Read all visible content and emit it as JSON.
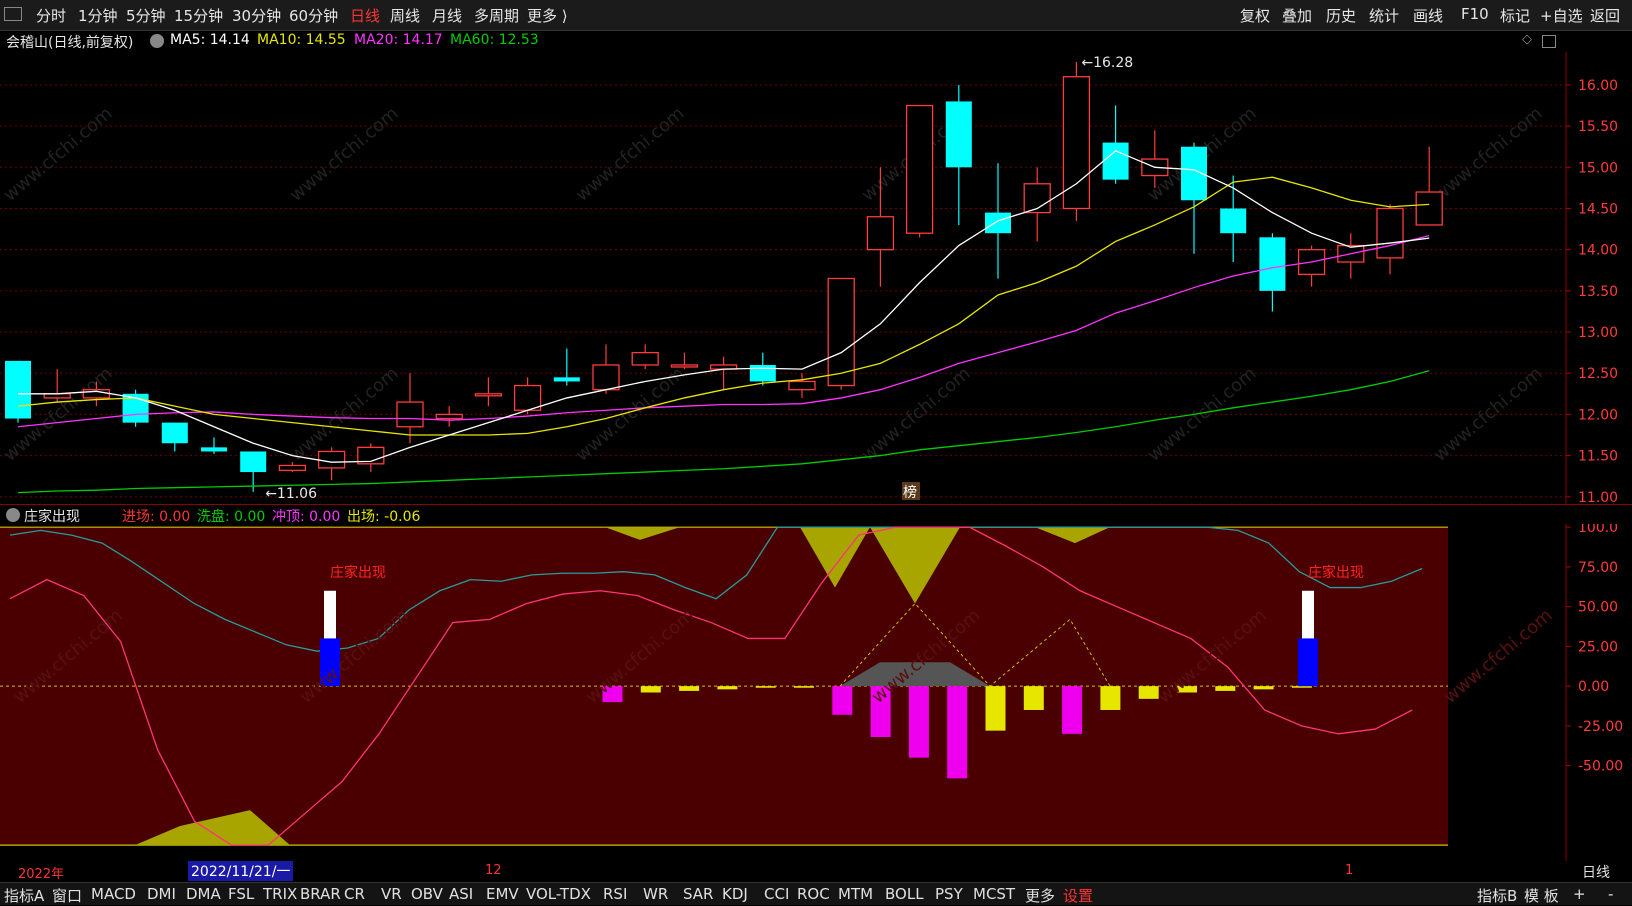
{
  "toolbar": {
    "left_items": [
      "分时",
      "1分钟",
      "5分钟",
      "15分钟",
      "30分钟",
      "60分钟",
      "日线",
      "周线",
      "月线",
      "多周期",
      "更多 ⟩"
    ],
    "active_item": "日线",
    "right_items": [
      "复权",
      "叠加",
      "历史",
      "统计",
      "画线",
      "F10",
      "标记",
      "+自选",
      "返回"
    ]
  },
  "main_legend": {
    "stock": "会稽山(日线,前复权)",
    "ma5_label": "MA5: 14.14",
    "ma10_label": "MA10: 14.55",
    "ma20_label": "MA20: 14.17",
    "ma60_label": "MA60: 12.53",
    "colors": {
      "ma5": "#ffffff",
      "ma10": "#e6e600",
      "ma20": "#ff33ff",
      "ma60": "#00cc00"
    }
  },
  "price_axis": [
    "16.00",
    "15.50",
    "15.00",
    "14.50",
    "14.00",
    "13.50",
    "13.00",
    "12.50",
    "12.00",
    "11.50",
    "11.00"
  ],
  "annotations": {
    "high": "16.28",
    "low": "11.06",
    "rank_badge": "榜"
  },
  "sub_legend": {
    "name": "庄家出现",
    "entry_label": "进场: 0.00",
    "wash_label": "洗盘: 0.00",
    "rush_label": "冲顶: 0.00",
    "exit_label": "出场: -0.06"
  },
  "sub_axis": [
    "100.0",
    "75.00",
    "50.00",
    "25.00",
    "0.00",
    "-25.00",
    "-50.00"
  ],
  "sub_annotations": [
    "庄家出现",
    "庄家出现"
  ],
  "date_bar": {
    "year": "2022年",
    "cursor_date": "2022/11/21/一",
    "month_12": "12",
    "month_1": "1",
    "period": "日线"
  },
  "bottom_tabs": [
    "指标A",
    "窗口",
    "MACD",
    "DMI",
    "DMA",
    "FSL",
    "TRIX",
    "BRAR",
    "CR",
    "VR",
    "OBV",
    "ASI",
    "EMV",
    "VOL-TDX",
    "RSI",
    "WR",
    "SAR",
    "KDJ",
    "CCI",
    "ROC",
    "MTM",
    "BOLL",
    "PSY",
    "MCST",
    "更多",
    "设置"
  ],
  "bottom_right": [
    "指标B",
    "模 板",
    "+",
    "-"
  ],
  "watermark": "www.cfchi.com",
  "chart_data": {
    "type": "candlestick",
    "candles": [
      {
        "o": 12.65,
        "c": 11.95,
        "h": 12.65,
        "l": 11.9
      },
      {
        "o": 12.2,
        "c": 12.25,
        "h": 12.55,
        "l": 12.15
      },
      {
        "o": 12.2,
        "c": 12.3,
        "h": 12.4,
        "l": 12.1
      },
      {
        "o": 12.25,
        "c": 11.9,
        "h": 12.3,
        "l": 11.85
      },
      {
        "o": 11.9,
        "c": 11.65,
        "h": 11.9,
        "l": 11.55
      },
      {
        "o": 11.6,
        "c": 11.55,
        "h": 11.72,
        "l": 11.52
      },
      {
        "o": 11.55,
        "c": 11.3,
        "h": 11.55,
        "l": 11.06
      },
      {
        "o": 11.32,
        "c": 11.38,
        "h": 11.42,
        "l": 11.3
      },
      {
        "o": 11.35,
        "c": 11.55,
        "h": 11.6,
        "l": 11.2
      },
      {
        "o": 11.4,
        "c": 11.6,
        "h": 11.65,
        "l": 11.3
      },
      {
        "o": 11.85,
        "c": 12.15,
        "h": 12.5,
        "l": 11.65
      },
      {
        "o": 11.95,
        "c": 12.0,
        "h": 12.1,
        "l": 11.85
      },
      {
        "o": 12.25,
        "c": 12.25,
        "h": 12.45,
        "l": 12.1
      },
      {
        "o": 12.05,
        "c": 12.35,
        "h": 12.45,
        "l": 12.0
      },
      {
        "o": 12.45,
        "c": 12.4,
        "h": 12.8,
        "l": 12.35
      },
      {
        "o": 12.3,
        "c": 12.6,
        "h": 12.85,
        "l": 12.25
      },
      {
        "o": 12.6,
        "c": 12.75,
        "h": 12.85,
        "l": 12.55
      },
      {
        "o": 12.6,
        "c": 12.6,
        "h": 12.75,
        "l": 12.55
      },
      {
        "o": 12.55,
        "c": 12.6,
        "h": 12.7,
        "l": 12.3
      },
      {
        "o": 12.6,
        "c": 12.4,
        "h": 12.75,
        "l": 12.35
      },
      {
        "o": 12.3,
        "c": 12.4,
        "h": 12.5,
        "l": 12.2
      },
      {
        "o": 12.35,
        "c": 13.65,
        "h": 13.65,
        "l": 12.3
      },
      {
        "o": 14.0,
        "c": 14.4,
        "h": 15.0,
        "l": 13.55
      },
      {
        "o": 14.2,
        "c": 15.75,
        "h": 15.75,
        "l": 14.15
      },
      {
        "o": 15.8,
        "c": 15.0,
        "h": 16.0,
        "l": 14.3
      },
      {
        "o": 14.45,
        "c": 14.2,
        "h": 15.05,
        "l": 13.65
      },
      {
        "o": 14.45,
        "c": 14.8,
        "h": 15.0,
        "l": 14.1
      },
      {
        "o": 14.5,
        "c": 16.1,
        "h": 16.28,
        "l": 14.35
      },
      {
        "o": 15.3,
        "c": 14.85,
        "h": 15.75,
        "l": 14.8
      },
      {
        "o": 14.9,
        "c": 15.1,
        "h": 15.45,
        "l": 14.75
      },
      {
        "o": 15.25,
        "c": 14.6,
        "h": 15.3,
        "l": 13.95
      },
      {
        "o": 14.5,
        "c": 14.2,
        "h": 14.9,
        "l": 13.85
      },
      {
        "o": 14.15,
        "c": 13.5,
        "h": 14.2,
        "l": 13.25
      },
      {
        "o": 13.7,
        "c": 14.0,
        "h": 14.05,
        "l": 13.55
      },
      {
        "o": 13.85,
        "c": 14.05,
        "h": 14.2,
        "l": 13.65
      },
      {
        "o": 13.9,
        "c": 14.5,
        "h": 14.55,
        "l": 13.7
      },
      {
        "o": 14.3,
        "c": 14.7,
        "h": 15.25,
        "l": 14.3
      }
    ],
    "ma5": [
      12.25,
      12.25,
      12.28,
      12.2,
      12.05,
      11.85,
      11.65,
      11.5,
      11.42,
      11.43,
      11.6,
      11.75,
      11.9,
      12.05,
      12.2,
      12.3,
      12.4,
      12.48,
      12.55,
      12.56,
      12.55,
      12.75,
      13.1,
      13.6,
      14.05,
      14.35,
      14.5,
      14.8,
      15.2,
      15.0,
      14.97,
      14.75,
      14.45,
      14.2,
      14.03,
      14.08,
      14.14
    ],
    "ma10": [
      12.1,
      12.15,
      12.18,
      12.2,
      12.1,
      12.0,
      11.95,
      11.9,
      11.85,
      11.8,
      11.75,
      11.75,
      11.75,
      11.77,
      11.85,
      11.95,
      12.08,
      12.2,
      12.3,
      12.38,
      12.42,
      12.5,
      12.62,
      12.85,
      13.1,
      13.45,
      13.6,
      13.8,
      14.1,
      14.3,
      14.52,
      14.82,
      14.88,
      14.75,
      14.6,
      14.52,
      14.55
    ],
    "ma20": [
      11.85,
      11.9,
      11.95,
      12.0,
      12.02,
      12.03,
      12.0,
      11.98,
      11.96,
      11.95,
      11.95,
      11.93,
      11.95,
      11.98,
      12.02,
      12.05,
      12.08,
      12.1,
      12.12,
      12.12,
      12.13,
      12.2,
      12.3,
      12.45,
      12.62,
      12.75,
      12.88,
      13.02,
      13.23,
      13.38,
      13.54,
      13.68,
      13.78,
      13.85,
      13.95,
      14.05,
      14.17
    ],
    "ma60": [
      11.05,
      11.07,
      11.08,
      11.1,
      11.11,
      11.12,
      11.13,
      11.14,
      11.15,
      11.16,
      11.18,
      11.2,
      11.22,
      11.24,
      11.26,
      11.28,
      11.3,
      11.32,
      11.34,
      11.37,
      11.4,
      11.45,
      11.5,
      11.57,
      11.62,
      11.67,
      11.72,
      11.78,
      11.85,
      11.93,
      12.0,
      12.08,
      12.15,
      12.22,
      12.3,
      12.4,
      12.53
    ],
    "osc_teal": [
      95,
      98,
      95,
      90,
      78,
      65,
      52,
      42,
      34,
      26,
      22,
      24,
      30,
      48,
      60,
      67,
      66,
      70,
      71,
      71,
      72,
      70,
      62,
      55,
      70,
      100,
      100,
      100,
      100,
      100,
      100,
      100,
      100,
      100,
      100,
      100,
      100,
      100,
      100,
      100,
      98,
      90,
      72,
      62,
      62,
      66,
      74
    ],
    "osc_pink": [
      55,
      67,
      57,
      28,
      -40,
      -85,
      -115,
      -100,
      -80,
      -60,
      -30,
      5,
      40,
      42,
      52,
      58,
      60,
      57,
      48,
      40,
      30,
      30,
      65,
      95,
      100,
      100,
      100,
      88,
      75,
      60,
      50,
      40,
      30,
      12,
      -15,
      -25,
      -30,
      -27,
      -15
    ],
    "osc_bars": [
      0,
      0,
      0,
      0,
      0,
      0,
      0,
      0,
      0,
      0,
      0,
      0,
      0,
      0,
      0,
      -10,
      -4,
      -3,
      -2,
      -1,
      -1,
      -18,
      -32,
      -45,
      -58,
      -28,
      -15,
      -30,
      -15,
      -8,
      -4,
      -3,
      -2,
      -1,
      0
    ],
    "signal_bars": [
      {
        "index": 8,
        "white": [
          30,
          60
        ],
        "blue": [
          0,
          30
        ]
      },
      {
        "index": 33,
        "white": [
          30,
          60
        ],
        "blue": [
          0,
          30
        ]
      }
    ],
    "ylim": [
      10.9,
      16.4
    ],
    "sub_ylim": [
      -110,
      102
    ]
  }
}
